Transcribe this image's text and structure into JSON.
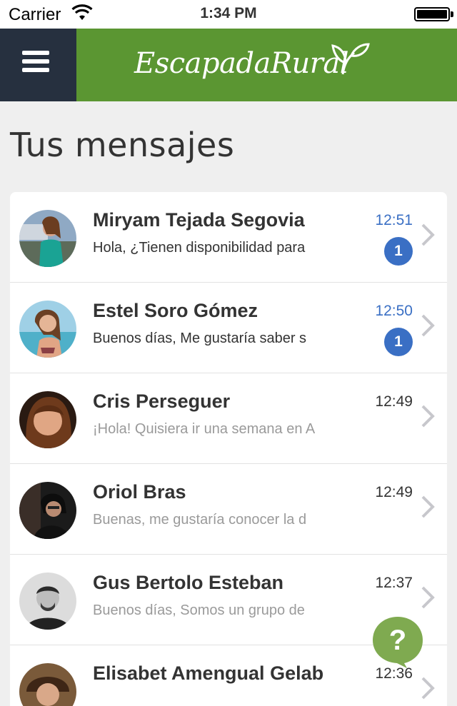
{
  "status_bar": {
    "carrier": "Carrier",
    "time": "1:34 PM"
  },
  "navbar": {
    "logo_text": "EscapadaRural",
    "menu_icon": "hamburger-icon"
  },
  "page": {
    "title": "Tus mensajes"
  },
  "colors": {
    "brand_green": "#5b9632",
    "menu_bg": "#26303f",
    "unread_blue": "#3a6fc4"
  },
  "messages": [
    {
      "name": "Miryam Tejada Segovia",
      "preview": "Hola, ¿Tienen disponibilidad para",
      "time": "12:51",
      "unread": true,
      "badge": "1"
    },
    {
      "name": "Estel Soro Gómez",
      "preview": "Buenos días, Me gustaría saber s",
      "time": "12:50",
      "unread": true,
      "badge": "1"
    },
    {
      "name": "Cris Perseguer",
      "preview": "¡Hola! Quisiera ir una semana en A",
      "time": "12:49",
      "unread": false
    },
    {
      "name": "Oriol Bras",
      "preview": "Buenas, me gustaría conocer la d",
      "time": "12:49",
      "unread": false
    },
    {
      "name": "Gus Bertolo Esteban",
      "preview": "Buenos días, Somos un grupo de",
      "time": "12:37",
      "unread": false
    },
    {
      "name": "Elisabet Amengual Gelab",
      "preview": "",
      "time": "12:36",
      "unread": false
    }
  ],
  "help": {
    "icon": "help-bubble-icon"
  }
}
